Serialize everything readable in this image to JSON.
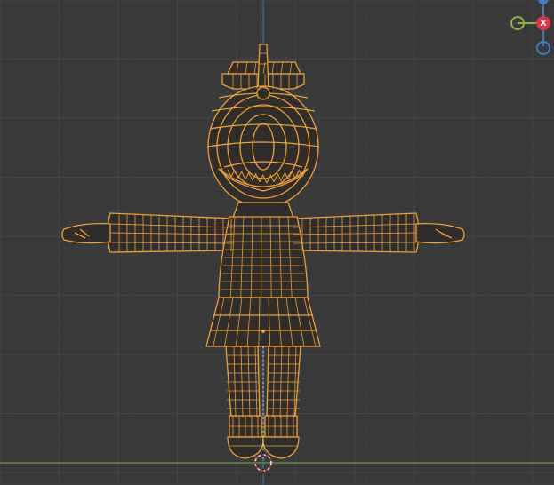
{
  "viewport": {
    "mode": "wireframe-front-orthographic",
    "background_color": "#393939",
    "grid_minor_color": "#3e3e3e",
    "grid_major_color": "#454545",
    "axis_z_color": "#4772b3",
    "axis_y_color": "#6e9a32",
    "wire_color": "#f0a030",
    "wire_dark_color": "#c77817",
    "model_fill_color": "#2f2e2d"
  },
  "nav_gizmo": {
    "x_label": "X",
    "x_color": "#e8304a",
    "y_color": "#8bb53d",
    "z_color": "#3d7cc8"
  },
  "scene": {
    "object": "cartoon-shark-character",
    "icons": [
      "origin-point",
      "3d-cursor"
    ]
  }
}
